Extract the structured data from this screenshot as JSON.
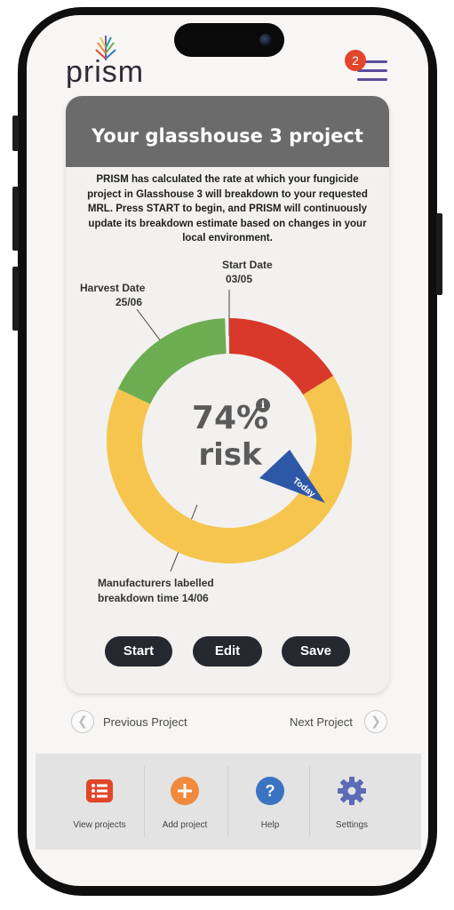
{
  "app": {
    "logo_text": "prism",
    "menu_badge": "2"
  },
  "card": {
    "title": "Your glasshouse 3 project",
    "description": "PRISM has calculated the rate at which your fungicide project in Glasshouse 3 will breakdown to your requested MRL. Press START to begin, and PRISM will continuously update its breakdown estimate based on changes in your local environment.",
    "start_date_label": "Start Date",
    "start_date": "03/05",
    "harvest_date_label": "Harvest Date",
    "harvest_date": "25/06",
    "manufacturer_label_line1": "Manufacturers labelled",
    "manufacturer_label_line2": "breakdown time 14/06",
    "risk_value": "74%",
    "risk_word": "risk",
    "today_label": "Today",
    "buttons": {
      "start": "Start",
      "edit": "Edit",
      "save": "Save"
    }
  },
  "project_nav": {
    "previous": "Previous Project",
    "next": "Next Project"
  },
  "tabbar": {
    "items": [
      {
        "label": "View projects",
        "icon": "list-icon",
        "color": "#e2452a"
      },
      {
        "label": "Add project",
        "icon": "plus-icon",
        "color": "#f08a3c"
      },
      {
        "label": "Help",
        "icon": "question-icon",
        "color": "#3a73c0"
      },
      {
        "label": "Settings",
        "icon": "gear-icon",
        "color": "#5b6bb5"
      }
    ]
  },
  "colors": {
    "red_segment": "#d8392b",
    "yellow_segment": "#f5c54e",
    "green_segment": "#6cad52",
    "today_marker": "#2d58a8"
  }
}
